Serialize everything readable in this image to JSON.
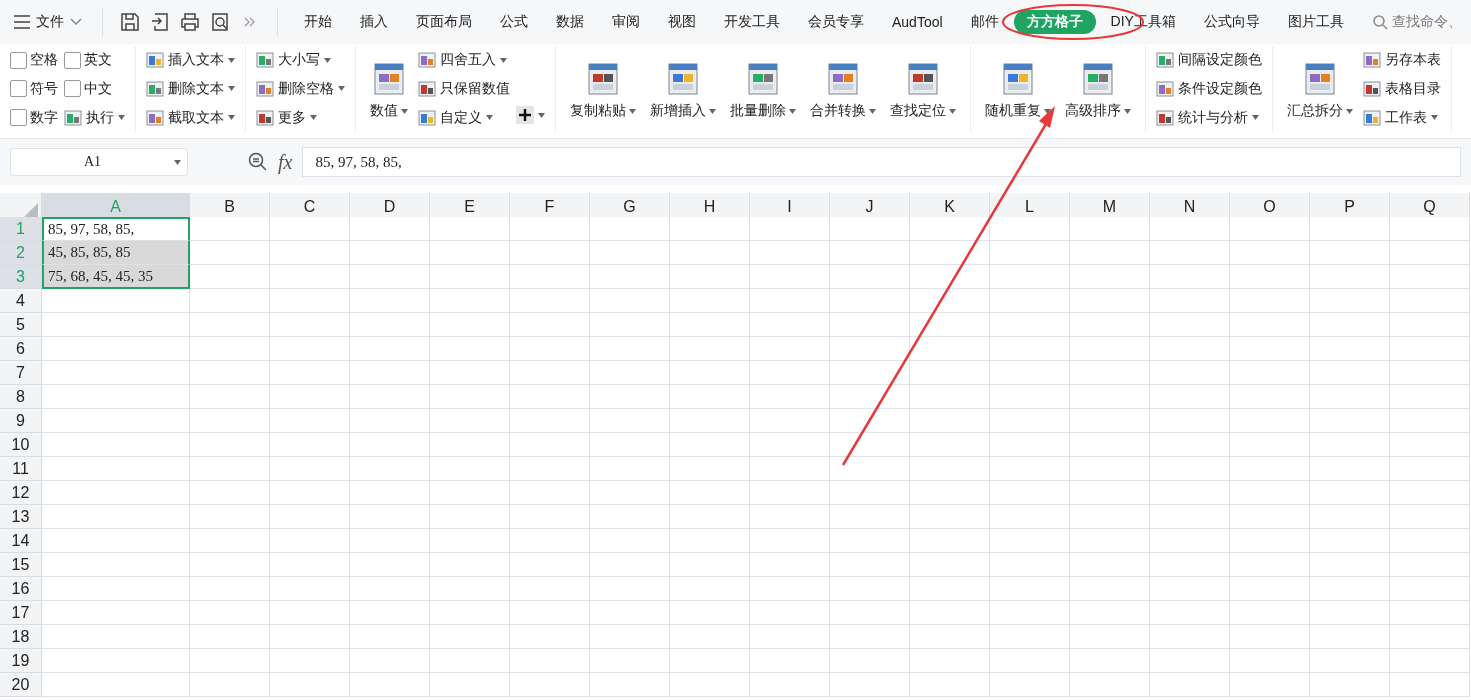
{
  "menu_bar": {
    "file_label": "文件",
    "tabs": [
      {
        "label": "开始",
        "selected": false
      },
      {
        "label": "插入",
        "selected": false
      },
      {
        "label": "页面布局",
        "selected": false
      },
      {
        "label": "公式",
        "selected": false
      },
      {
        "label": "数据",
        "selected": false
      },
      {
        "label": "审阅",
        "selected": false
      },
      {
        "label": "视图",
        "selected": false
      },
      {
        "label": "开发工具",
        "selected": false
      },
      {
        "label": "会员专享",
        "selected": false
      },
      {
        "label": "AudTool",
        "selected": false
      },
      {
        "label": "邮件",
        "selected": false
      },
      {
        "label": "方方格子",
        "selected": true
      },
      {
        "label": "DIY工具箱",
        "selected": false
      },
      {
        "label": "公式向导",
        "selected": false
      },
      {
        "label": "图片工具",
        "selected": false
      }
    ],
    "search": {
      "placeholder": "查找命令、"
    }
  },
  "ribbon": [
    {
      "columns": [
        [
          {
            "kind": "check",
            "label": "空格",
            "checked": false
          },
          {
            "kind": "check",
            "label": "符号",
            "checked": false
          },
          {
            "kind": "check",
            "label": "数字",
            "checked": false
          }
        ],
        [
          {
            "kind": "check",
            "label": "英文",
            "checked": false
          },
          {
            "kind": "check",
            "label": "中文",
            "checked": false
          },
          {
            "kind": "small",
            "label": "执行",
            "dropdown": true
          }
        ]
      ]
    },
    {
      "columns": [
        [
          {
            "kind": "small",
            "label": "插入文本",
            "dropdown": true
          },
          {
            "kind": "small",
            "label": "删除文本",
            "dropdown": true
          },
          {
            "kind": "small",
            "label": "截取文本",
            "dropdown": true
          }
        ]
      ]
    },
    {
      "columns": [
        [
          {
            "kind": "small",
            "label": "大小写",
            "dropdown": true
          },
          {
            "kind": "small",
            "label": "删除空格",
            "dropdown": true
          },
          {
            "kind": "small",
            "label": "更多",
            "dropdown": true
          }
        ]
      ]
    },
    {
      "columns": [
        [
          {
            "kind": "large",
            "label": "数值",
            "dropdown": true
          }
        ],
        [
          {
            "kind": "small",
            "label": "四舍五入",
            "dropdown": true
          },
          {
            "kind": "small",
            "label": "只保留数值",
            "dropdown": false
          },
          {
            "kind": "small",
            "label": "自定义",
            "dropdown": true
          }
        ],
        [
          {
            "kind": "plus",
            "dropdown": true
          }
        ]
      ]
    },
    {
      "columns": [
        [
          {
            "kind": "large",
            "label": "复制粘贴",
            "dropdown": true
          }
        ],
        [
          {
            "kind": "large",
            "label": "新增插入",
            "dropdown": true
          }
        ],
        [
          {
            "kind": "large",
            "label": "批量删除",
            "dropdown": true
          }
        ],
        [
          {
            "kind": "large",
            "label": "合并转换",
            "dropdown": true
          }
        ],
        [
          {
            "kind": "large",
            "label": "查找定位",
            "dropdown": true
          }
        ]
      ]
    },
    {
      "columns": [
        [
          {
            "kind": "large",
            "label": "随机重复",
            "dropdown": true
          }
        ],
        [
          {
            "kind": "large",
            "label": "高级排序",
            "dropdown": true
          }
        ]
      ]
    },
    {
      "columns": [
        [
          {
            "kind": "small",
            "label": "间隔设定颜色",
            "dropdown": false
          },
          {
            "kind": "small",
            "label": "条件设定颜色",
            "dropdown": false
          },
          {
            "kind": "small",
            "label": "统计与分析",
            "dropdown": true
          }
        ]
      ]
    },
    {
      "columns": [
        [
          {
            "kind": "large",
            "label": "汇总拆分",
            "dropdown": true
          }
        ],
        [
          {
            "kind": "small",
            "label": "另存本表",
            "dropdown": false
          },
          {
            "kind": "small",
            "label": "表格目录",
            "dropdown": false
          },
          {
            "kind": "small",
            "label": "工作表",
            "dropdown": true
          }
        ]
      ]
    }
  ],
  "formula_bar": {
    "name_box": "A1",
    "function_label": "fx",
    "formula": "85, 97, 58, 85,"
  },
  "grid": {
    "columns": [
      {
        "label": "A",
        "selected": true
      },
      {
        "label": "B",
        "selected": false
      },
      {
        "label": "C",
        "selected": false
      },
      {
        "label": "D",
        "selected": false
      },
      {
        "label": "E",
        "selected": false
      },
      {
        "label": "F",
        "selected": false
      },
      {
        "label": "G",
        "selected": false
      },
      {
        "label": "H",
        "selected": false
      },
      {
        "label": "I",
        "selected": false
      },
      {
        "label": "J",
        "selected": false
      },
      {
        "label": "K",
        "selected": false
      },
      {
        "label": "L",
        "selected": false
      },
      {
        "label": "M",
        "selected": false
      },
      {
        "label": "N",
        "selected": false
      },
      {
        "label": "O",
        "selected": false
      },
      {
        "label": "P",
        "selected": false
      },
      {
        "label": "Q",
        "selected": false
      }
    ],
    "rows": [
      {
        "label": "1",
        "selected": true,
        "active": true,
        "value": "85, 97, 58, 85,"
      },
      {
        "label": "2",
        "selected": true,
        "active": false,
        "value": "45, 85, 85, 85"
      },
      {
        "label": "3",
        "selected": true,
        "active": false,
        "value": "75, 68, 45, 45, 35"
      },
      {
        "label": "4",
        "selected": false
      },
      {
        "label": "5",
        "selected": false
      },
      {
        "label": "6",
        "selected": false
      },
      {
        "label": "7",
        "selected": false
      },
      {
        "label": "8",
        "selected": false
      },
      {
        "label": "9",
        "selected": false
      },
      {
        "label": "10",
        "selected": false
      },
      {
        "label": "11",
        "selected": false
      },
      {
        "label": "12",
        "selected": false
      },
      {
        "label": "13",
        "selected": false
      },
      {
        "label": "14",
        "selected": false
      },
      {
        "label": "15",
        "selected": false
      },
      {
        "label": "16",
        "selected": false
      },
      {
        "label": "17",
        "selected": false
      },
      {
        "label": "18",
        "selected": false
      },
      {
        "label": "19",
        "selected": false
      },
      {
        "label": "20",
        "selected": false
      }
    ]
  },
  "annotations": {
    "highlight_ellipse": {
      "color": "#e8383a"
    },
    "pointer_arrow": {
      "color": "#e8383a"
    }
  }
}
